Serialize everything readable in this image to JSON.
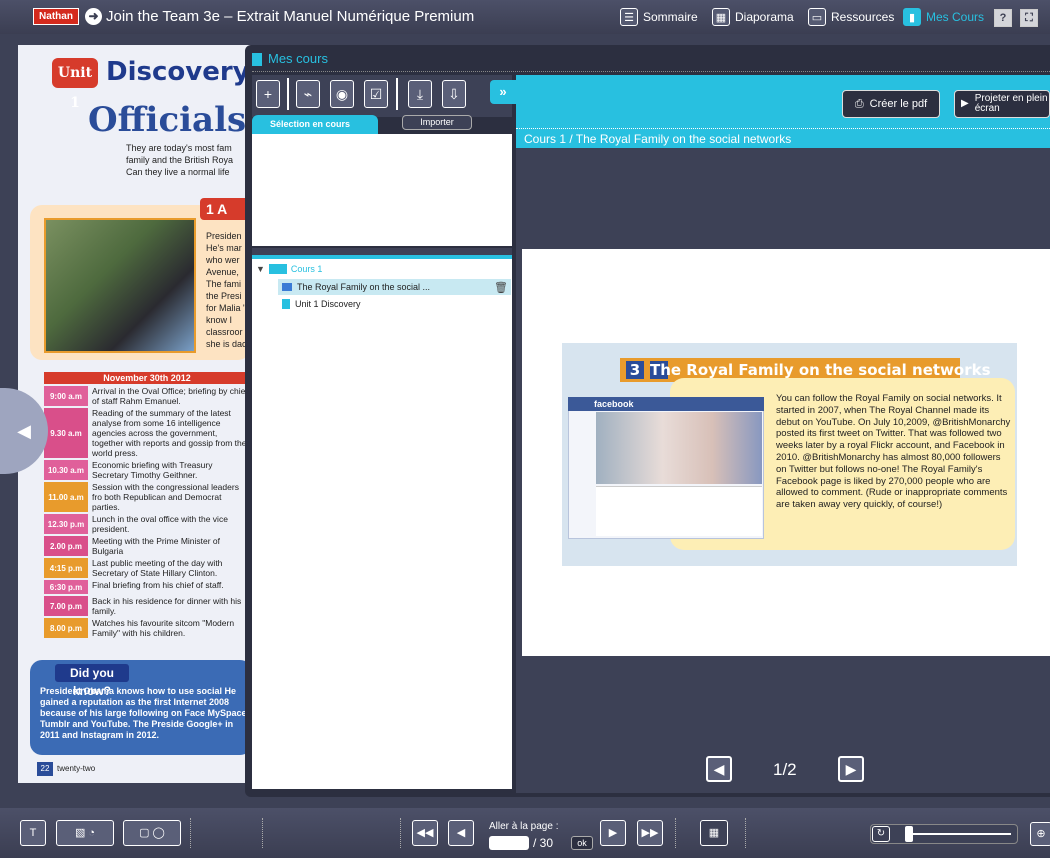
{
  "topbar": {
    "logo": "Nathan",
    "title": "Join the Team 3e – Extrait Manuel Numérique Premium",
    "nav": [
      {
        "label": "Sommaire",
        "icon": "list-icon"
      },
      {
        "label": "Diaporama",
        "icon": "grid-icon"
      },
      {
        "label": "Ressources",
        "icon": "folder-icon"
      },
      {
        "label": "Mes Cours",
        "icon": "course-icon",
        "active": true
      }
    ],
    "help": "?",
    "fullscreen": "⛶"
  },
  "book": {
    "unit": "Unit 1",
    "title": "Discovery",
    "heading": "Officials a",
    "intro": "They are today's most fam family and the British Roya Can they live a normal life",
    "section": "1 A",
    "side_text": "Presiden He's mar who wer Avenue, The fami the Presi for Malia \"I know I classroor she is dac",
    "schedule_title": "November 30th 2012",
    "schedule": [
      {
        "time": "9:00 a.m",
        "text": "Arrival in the Oval Office; briefing by chief of staff Rahm Emanuel.",
        "color": "#e0609a"
      },
      {
        "time": "9.30 a.m",
        "text": "Reading of the summary of the latest analyse from some 16 intelligence agencies across the government, together with reports and gossip from the world press.",
        "color": "#d94f8a"
      },
      {
        "time": "10.30 a.m",
        "text": "Economic briefing with Treasury Secretary Timothy Geithner.",
        "color": "#e0609a"
      },
      {
        "time": "11.00 a.m",
        "text": "Session with the congressional leaders fro both Republican and Democrat parties.",
        "color": "#e89b2c"
      },
      {
        "time": "12.30 p.m",
        "text": "Lunch in the oval office with the vice president.",
        "color": "#e0609a"
      },
      {
        "time": "2.00 p.m",
        "text": "Meeting with the Prime Minister of Bulgaria",
        "color": "#d94f8a"
      },
      {
        "time": "4:15 p.m",
        "text": "Last public meeting of the day with Secretary of State Hillary Clinton.",
        "color": "#e89b2c"
      },
      {
        "time": "6:30 p.m",
        "text": "Final briefing from his chief of staff.",
        "color": "#e0609a"
      },
      {
        "time": "7.00 p.m",
        "text": "Back in his residence for dinner with his family.",
        "color": "#d94f8a"
      },
      {
        "time": "8.00 p.m",
        "text": "Watches his favourite sitcom \"Modern Family\" with his children.",
        "color": "#e89b2c"
      }
    ],
    "did_you_know": "Did you know?",
    "did_text": "President Obama knows how to use social He gained a reputation as the first Internet 2008 because of his large following on Face MySpace, Tumblr and YouTube. The Preside Google+ in 2011 and Instagram in 2012.",
    "page_number": "22",
    "page_word": "twenty-two"
  },
  "panel": {
    "title": "Mes cours",
    "tab_selection": "Sélection en cours",
    "tab_import": "Importer",
    "expand": "»",
    "tree_root": "Cours 1",
    "tree_items": [
      {
        "label": "The Royal Family on the social ..."
      },
      {
        "label": "Unit 1 Discovery"
      }
    ]
  },
  "viewer": {
    "btn_pdf": "Créer le pdf",
    "btn_project": "Projeter en plein écran",
    "course_title": "Cours 1 / The Royal Family on the social networks",
    "slide_section": "3",
    "slide_heading": "The Royal Family on the social networks",
    "fb_label": "facebook",
    "slide_text": "You can follow the Royal Family on social networks. It started in 2007, when The Royal Channel made its debut on YouTube. On July 10,2009, @BritishMonarchy posted its first tweet on Twitter. That was followed two weeks later by a royal Flickr account, and Facebook in 2010. @BritishMonarchy has almost 80,000 followers on Twitter but follows no-one! The Royal Family's Facebook page is liked by 270,000 people who are allowed to comment. (Rude or inappropriate comments are taken away very quickly, of course!)",
    "pager": "1/2"
  },
  "bottombar": {
    "goto_label": "Aller à la page :",
    "goto_value": "",
    "goto_total": "/ 30",
    "ok": "ok"
  }
}
